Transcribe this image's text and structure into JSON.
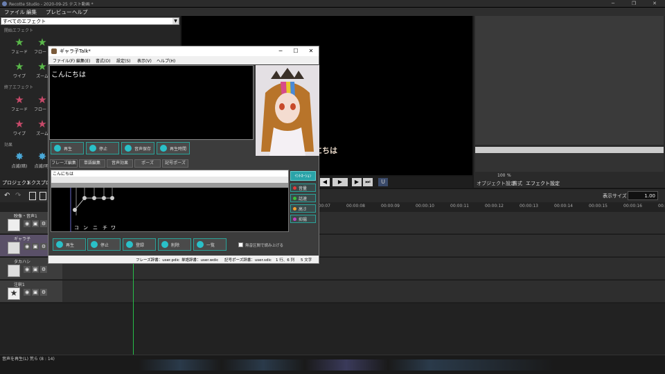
{
  "app": {
    "title": "Recotte Studio - 2020-09-25 テスト動画 *",
    "menu": [
      "ファイル",
      "編集",
      "プレビュー",
      "ヘルプ"
    ]
  },
  "effects": {
    "category": "すべてのエフェクト",
    "sections": [
      {
        "title": "開始エフェクト",
        "items": [
          "フェード",
          "フロート",
          "ワイプ",
          "ズーム"
        ]
      },
      {
        "title": "終了エフェクト",
        "items": [
          "フェード",
          "フロート",
          "ワイプ",
          "ズーム"
        ]
      },
      {
        "title": "効果",
        "items": [
          "点滅(暗)",
          "点滅(明)"
        ]
      }
    ],
    "tabs": [
      "プロジェクト",
      "エクスプロー"
    ]
  },
  "preview": {
    "subtitle": "にちは"
  },
  "right_panel": {
    "zoom_value": "100",
    "zoom_unit": "%",
    "tabs": [
      "オブジェクト設定",
      "書式",
      "エフェクト設定"
    ]
  },
  "timeline": {
    "display_size_label": "表示サイズ",
    "display_size_value": "1.00",
    "ticks": [
      "00:00:07",
      "00:00:08",
      "00:00:09",
      "00:00:10",
      "00:00:11",
      "00:00:12",
      "00:00:13",
      "00:00:14",
      "00:00:15",
      "00:00:16",
      "00:00:17"
    ],
    "tracks": [
      {
        "name": "映像・音声1"
      },
      {
        "name": "ギャラ子"
      },
      {
        "name": "タカハシ"
      },
      {
        "name": "注釈1"
      }
    ],
    "status": "音声を再生(L) 荒ら (8 : 14)"
  },
  "dialog": {
    "title": "ギャラ子Talk*",
    "menu": [
      "ファイル(F)",
      "編集(E)",
      "書式(O)",
      "設定(S)",
      "表示(V)",
      "ヘルプ(H)"
    ],
    "text": "こんにちは",
    "top_buttons": [
      "再生",
      "停止",
      "音声保存",
      "再生時間"
    ],
    "tabs": [
      "フレーズ編集",
      "単語編集",
      "音声効果",
      "ポーズ",
      "記号ポーズ"
    ],
    "phrase_text": "こんにちは",
    "morae": [
      "コ",
      "ン",
      "ニ",
      "チ",
      "ワ"
    ],
    "side_buttons": [
      {
        "label": "音量",
        "color": "#e03a3a"
      },
      {
        "label": "話速",
        "color": "#3ac03a"
      },
      {
        "label": "高さ",
        "color": "#f0a030"
      },
      {
        "label": "抑揚",
        "color": "#c040c0"
      }
    ],
    "intonation_label": "ｲﾝﾄﾈｰｼｮﾝ",
    "bottom_buttons": [
      "再生",
      "停止",
      "登録",
      "削除",
      "一覧"
    ],
    "checkbox_label": "無音区間で読み上げる",
    "status": [
      "フレーズ辞書：user.pdic",
      "単語辞書：user.wdic",
      "記号ポーズ辞書：user.sdic",
      "1 行、6 列",
      "5 文字"
    ]
  }
}
